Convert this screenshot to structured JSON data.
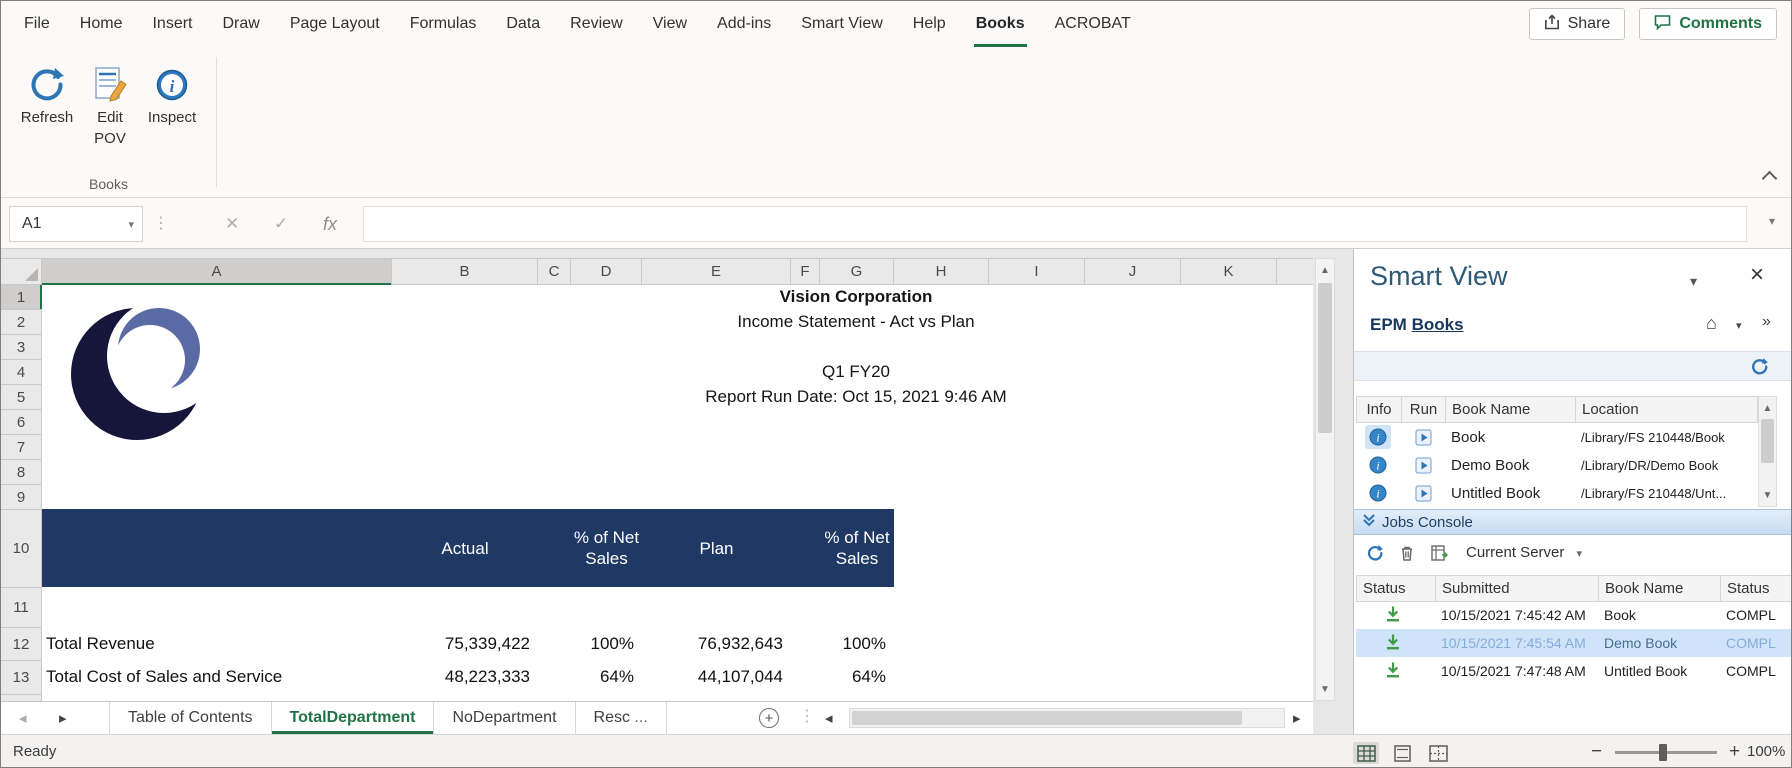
{
  "ribbon_tabs": {
    "items": [
      "File",
      "Home",
      "Insert",
      "Draw",
      "Page Layout",
      "Formulas",
      "Data",
      "Review",
      "View",
      "Add-ins",
      "Smart View",
      "Help",
      "Books",
      "ACROBAT"
    ]
  },
  "window_actions": {
    "share": "Share",
    "comments": "Comments"
  },
  "ribbon": {
    "refresh_label": "Refresh",
    "edit_pov_line1": "Edit",
    "edit_pov_line2": "POV",
    "inspect_label": "Inspect",
    "group_label": "Books"
  },
  "formula_bar": {
    "name_box": "A1",
    "fx_label": "fx"
  },
  "grid": {
    "columns": [
      "A",
      "B",
      "C",
      "D",
      "E",
      "F",
      "G",
      "H",
      "I",
      "J",
      "K"
    ],
    "rows": [
      "1",
      "2",
      "3",
      "4",
      "5",
      "6",
      "7",
      "8",
      "9",
      "10",
      "11",
      "12",
      "13"
    ]
  },
  "report": {
    "company": "Vision Corporation",
    "statement": "Income Statement - Act vs Plan",
    "period": "Q1 FY20",
    "run_date": "Report Run Date: Oct 15, 2021 9:46 AM",
    "col_headers": {
      "actual": "Actual",
      "actual_pct": "% of Net Sales",
      "plan": "Plan",
      "plan_pct": "% of Net Sales"
    },
    "rows": [
      {
        "label": "Total Revenue",
        "actual": "75,339,422",
        "actual_pct": "100%",
        "plan": "76,932,643",
        "plan_pct": "100%"
      },
      {
        "label": "Total Cost of Sales and Service",
        "actual": "48,223,333",
        "actual_pct": "64%",
        "plan": "44,107,044",
        "plan_pct": "64%"
      }
    ]
  },
  "sheet_tabs": {
    "items": [
      "Table of Contents",
      "TotalDepartment",
      "NoDepartment",
      "Resc"
    ],
    "overflow_indicator": "...",
    "active": "TotalDepartment"
  },
  "smart_view": {
    "title": "Smart View",
    "epm_prefix": "EPM ",
    "epm_link": "Books",
    "books": {
      "headers": [
        "Info",
        "Run",
        "Book Name",
        "Location"
      ],
      "rows": [
        {
          "name": "Book",
          "location": "/Library/FS 210448/Book"
        },
        {
          "name": "Demo Book",
          "location": "/Library/DR/Demo Book"
        },
        {
          "name": "Untitled Book",
          "location": "/Library/FS 210448/Unt..."
        }
      ]
    },
    "jobs": {
      "section_title": "Jobs Console",
      "server_selector": "Current Server",
      "headers": [
        "Status",
        "Submitted",
        "Book Name",
        "Status"
      ],
      "rows": [
        {
          "submitted": "10/15/2021 7:45:42 AM",
          "book": "Book",
          "status": "COMPL"
        },
        {
          "submitted": "10/15/2021 7:45:54 AM",
          "book": "Demo Book",
          "status": "COMPL"
        },
        {
          "submitted": "10/15/2021 7:47:48 AM",
          "book": "Untitled Book",
          "status": "COMPL"
        }
      ]
    }
  },
  "status_bar": {
    "mode": "Ready",
    "zoom": "100%"
  }
}
